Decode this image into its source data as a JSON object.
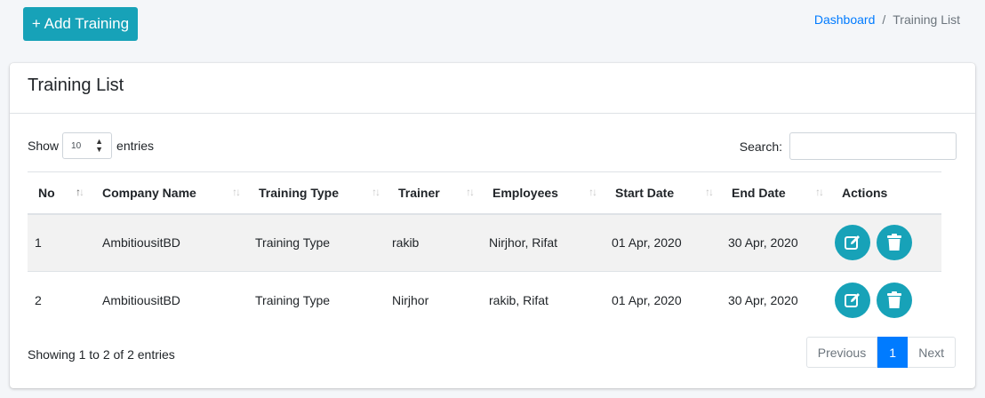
{
  "toolbar": {
    "add_label": "+ Add Training"
  },
  "breadcrumb": {
    "home": "Dashboard",
    "separator": "/",
    "current": "Training List"
  },
  "card": {
    "title": "Training List"
  },
  "length": {
    "show_label": "Show",
    "value": "10",
    "entries_label": "entries"
  },
  "search": {
    "label": "Search:",
    "value": ""
  },
  "table": {
    "headers": [
      "No",
      "Company Name",
      "Training Type",
      "Trainer",
      "Employees",
      "Start Date",
      "End Date",
      "Actions"
    ],
    "rows": [
      {
        "no": "1",
        "company": "AmbitiousitBD",
        "type": "Training Type",
        "trainer": "rakib",
        "employees": "Nirjhor, Rifat",
        "start": "01 Apr, 2020",
        "end": "30 Apr, 2020"
      },
      {
        "no": "2",
        "company": "AmbitiousitBD",
        "type": "Training Type",
        "trainer": "Nirjhor",
        "employees": "rakib, Rifat",
        "start": "01 Apr, 2020",
        "end": "30 Apr, 2020"
      }
    ]
  },
  "footer": {
    "info": "Showing 1 to 2 of 2 entries"
  },
  "pagination": {
    "previous": "Previous",
    "current": "1",
    "next": "Next"
  },
  "colors": {
    "accent": "#17a2b8",
    "primary": "#007bff"
  },
  "icons": {
    "edit": "edit-icon",
    "delete": "trash-icon",
    "sort": "sort-arrows-icon",
    "select": "select-caret-icon"
  }
}
